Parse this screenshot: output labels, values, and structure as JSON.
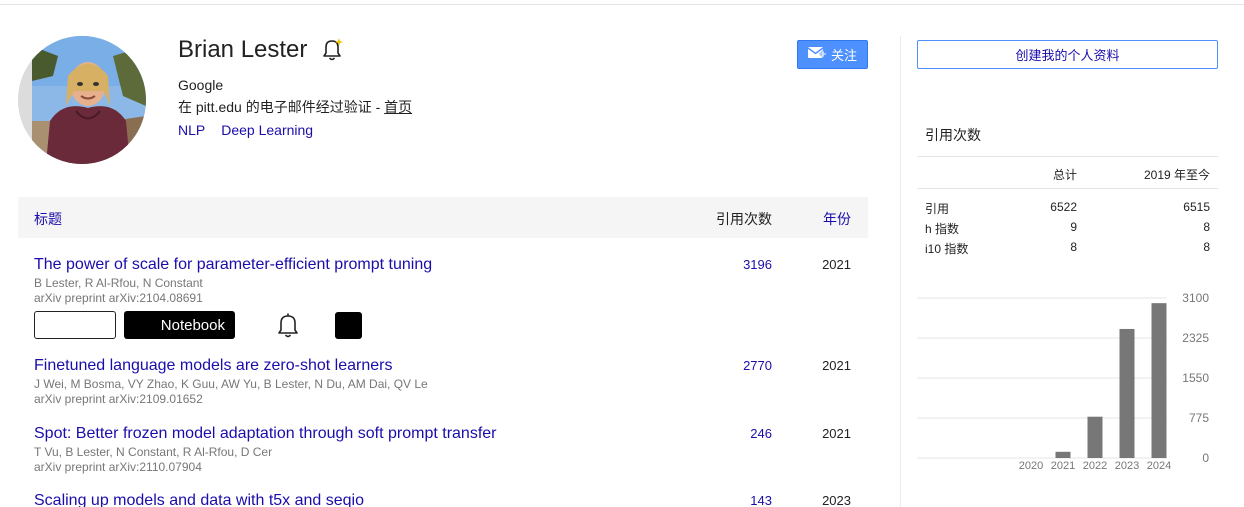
{
  "profile": {
    "name": "Brian Lester",
    "affiliation": "Google",
    "verified_prefix": "在 pitt.edu 的电子邮件经过验证 - ",
    "homepage_label": "首页",
    "tags": [
      "NLP",
      "Deep Learning"
    ],
    "follow_label": "关注"
  },
  "table": {
    "col_title": "标题",
    "col_cites": "引用次数",
    "col_year": "年份"
  },
  "publications": [
    {
      "title": "The power of scale for parameter-efficient prompt tuning",
      "authors": "B Lester, R Al-Rfou, N Constant",
      "venue": "arXiv preprint arXiv:2104.08691",
      "cites": "3196",
      "year": "2021"
    },
    {
      "title": "Finetuned language models are zero-shot learners",
      "authors": "J Wei, M Bosma, VY Zhao, K Guu, AW Yu, B Lester, N Du, AM Dai, QV Le",
      "venue": "arXiv preprint arXiv:2109.01652",
      "cites": "2770",
      "year": "2021"
    },
    {
      "title": "Spot: Better frozen model adaptation through soft prompt transfer",
      "authors": "T Vu, B Lester, N Constant, R Al-Rfou, D Cer",
      "venue": "arXiv preprint arXiv:2110.07904",
      "cites": "246",
      "year": "2021"
    },
    {
      "title": "Scaling up models and data with t5x and seqio",
      "authors": "",
      "venue": "",
      "cites": "143",
      "year": "2023"
    }
  ],
  "extension": {
    "notebook_label": "Notebook"
  },
  "sidebar": {
    "create_profile_label": "创建我的个人资料",
    "cited_by_title": "引用次数",
    "col_all": "总计",
    "col_since": "2019 年至今",
    "rows": [
      {
        "label": "引用",
        "all": "6522",
        "since": "6515"
      },
      {
        "label": "h 指数",
        "all": "9",
        "since": "8"
      },
      {
        "label": "i10 指数",
        "all": "8",
        "since": "8"
      }
    ]
  },
  "chart_data": {
    "type": "bar",
    "categories": [
      "2020",
      "2021",
      "2022",
      "2023",
      "2024"
    ],
    "values": [
      0,
      120,
      800,
      2500,
      3000
    ],
    "yticks": [
      "3100",
      "2325",
      "1550",
      "775",
      "0"
    ],
    "ylim": [
      0,
      3100
    ],
    "bar_color": "#777777",
    "grid": true
  },
  "colors": {
    "link": "#1a0dab",
    "follow_bg": "#4d90fe",
    "header_bg": "#f5f5f5"
  }
}
